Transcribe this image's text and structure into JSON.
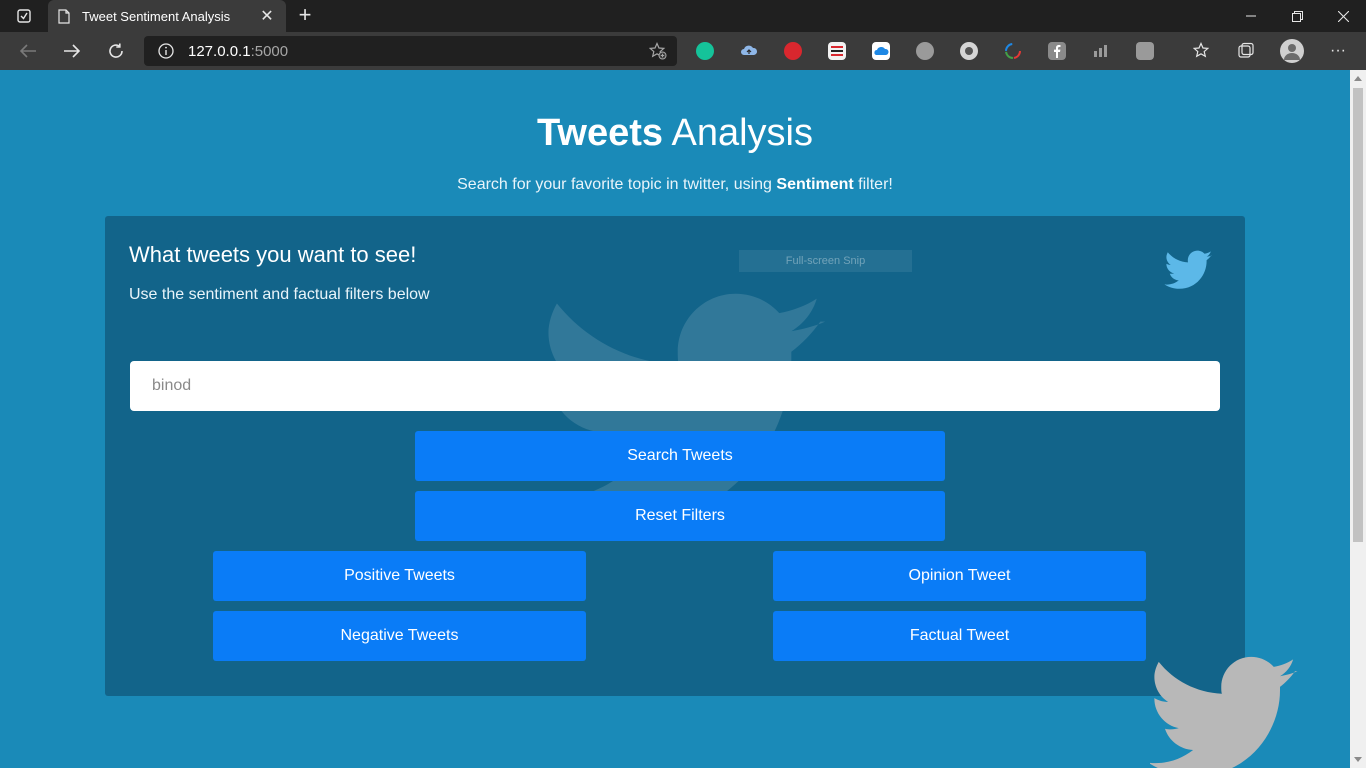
{
  "browser": {
    "tab_title": "Tweet Sentiment Analysis",
    "url_host": "127.0.0.1",
    "url_port": ":5000"
  },
  "page": {
    "heading_bold": "Tweets",
    "heading_light": " Analysis",
    "subheading_pre": "Search for your favorite topic in twitter, using ",
    "subheading_bold": "Sentiment",
    "subheading_post": " filter!"
  },
  "panel": {
    "title": "What tweets you want to see!",
    "subtitle": "Use the sentiment and factual filters below",
    "snip_label": "Full-screen Snip"
  },
  "search": {
    "value": "binod"
  },
  "buttons": {
    "search": "Search Tweets",
    "reset": "Reset Filters",
    "positive": "Positive Tweets",
    "negative": "Negative Tweets",
    "opinion": "Opinion Tweet",
    "factual": "Factual Tweet"
  },
  "colors": {
    "page_bg": "#1a8ab8",
    "button": "#0a7cf7",
    "panel": "#0c4664",
    "bird": "#5cb8e8"
  },
  "icons": {
    "extensions": [
      "grammarly-icon",
      "cloud-upload-icon",
      "mega-icon",
      "ext-red-stripes-icon",
      "onedrive-icon",
      "ext-circle-icon",
      "ext-record-icon",
      "ext-colorful-icon",
      "facebook-icon",
      "ext-chart-icon",
      "ext-k-icon"
    ]
  }
}
